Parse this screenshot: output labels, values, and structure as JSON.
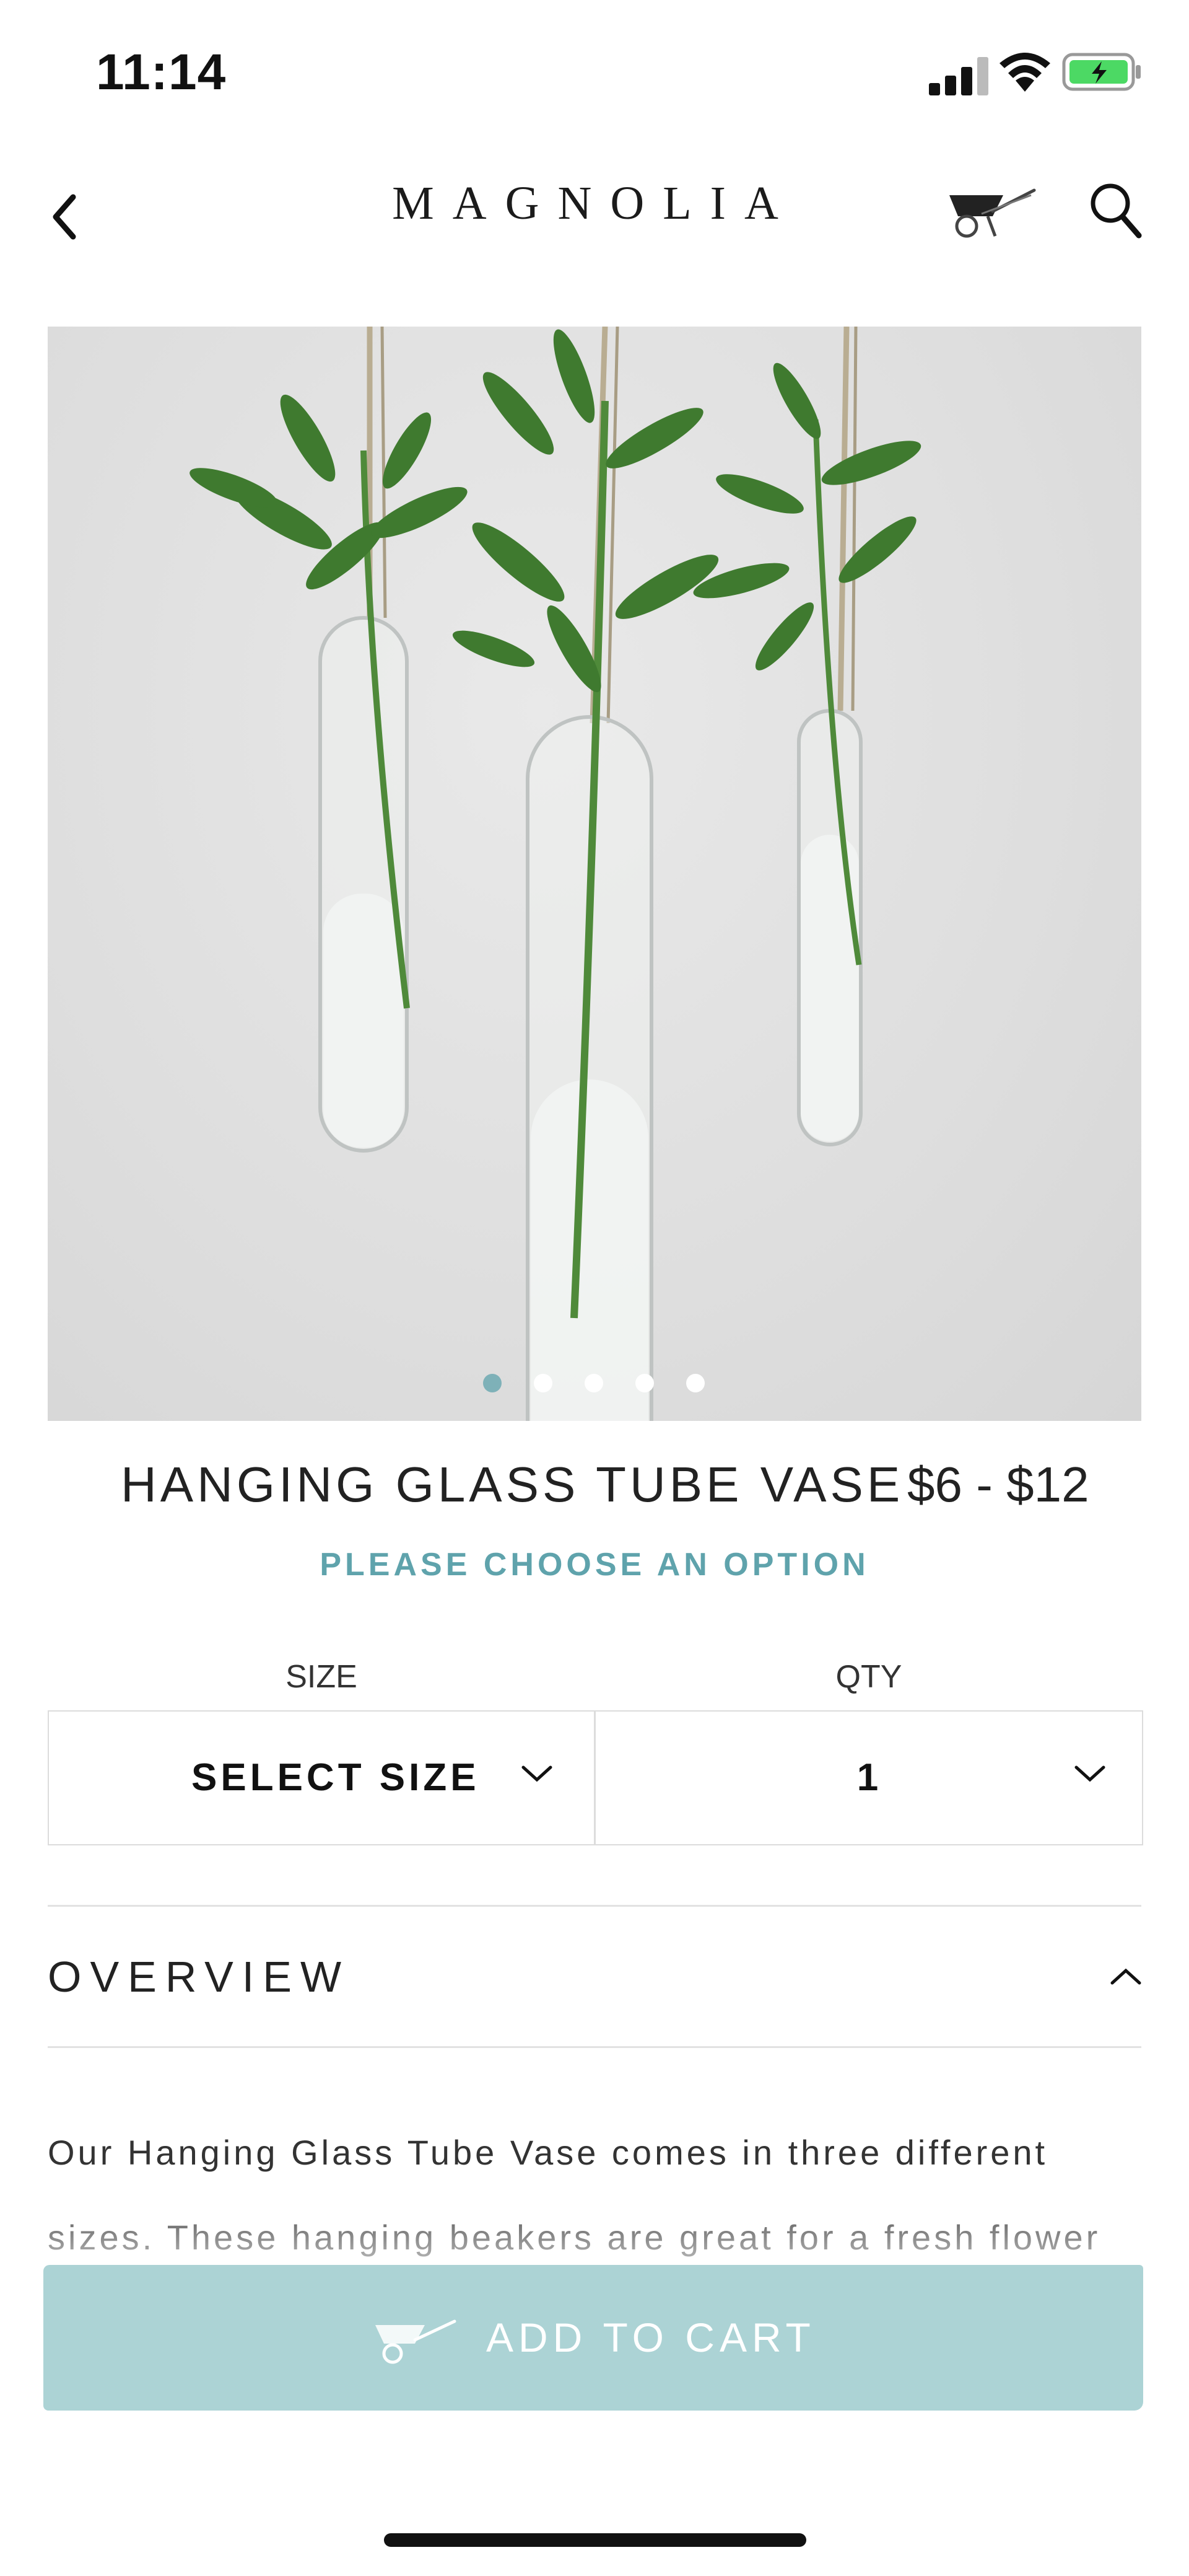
{
  "status_bar": {
    "time": "11:14",
    "signal_icon": "cellular-signal-icon",
    "wifi_icon": "wifi-icon",
    "battery_icon": "battery-charging-icon",
    "battery_color": "#4cd964"
  },
  "header": {
    "back_icon": "chevron-left-icon",
    "brand": "MAGNOLIA",
    "cart_icon": "wheelbarrow-cart-icon",
    "search_icon": "search-icon"
  },
  "gallery": {
    "image_subject": "hanging glass tube vases with green stems",
    "dots_count": 5,
    "active_dot": 0,
    "active_dot_color": "#7eb1b8"
  },
  "product": {
    "title": "HANGING GLASS TUBE VASE",
    "price": "$6 - $12",
    "option_prompt": "PLEASE CHOOSE AN OPTION"
  },
  "selectors": {
    "size_label": "SIZE",
    "size_value": "SELECT SIZE",
    "qty_label": "QTY",
    "qty_value": "1"
  },
  "overview": {
    "heading": "OVERVIEW",
    "text": "Our Hanging Glass Tube Vase comes in three different sizes. These hanging beakers are great for a fresh flower"
  },
  "cta": {
    "label": "ADD TO CART",
    "icon": "wheelbarrow-cart-icon",
    "color": "#acd3d5"
  },
  "accent_color": "#5fa3ac"
}
